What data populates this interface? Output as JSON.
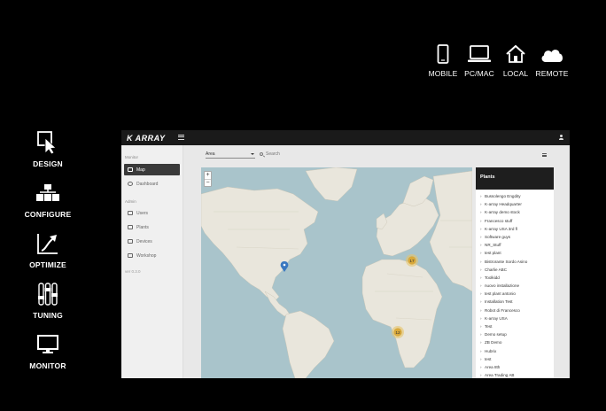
{
  "platforms": [
    {
      "icon": "mobile-icon",
      "label": "MOBILE"
    },
    {
      "icon": "laptop-icon",
      "label": "PC/MAC"
    },
    {
      "icon": "home-icon",
      "label": "LOCAL"
    },
    {
      "icon": "cloud-icon",
      "label": "REMOTE"
    }
  ],
  "features": [
    {
      "icon": "design-icon",
      "label": "DESIGN"
    },
    {
      "icon": "configure-icon",
      "label": "CONFIGURE"
    },
    {
      "icon": "optimize-icon",
      "label": "OPTIMIZE"
    },
    {
      "icon": "tuning-icon",
      "label": "TUNING"
    },
    {
      "icon": "monitor-icon",
      "label": "MONITOR"
    }
  ],
  "app": {
    "logo_text": "K ARRAY",
    "sidebar": {
      "section_monitor": "Monitor",
      "items_monitor": [
        {
          "label": "Map",
          "active": true
        },
        {
          "label": "Dashboard",
          "active": false
        }
      ],
      "section_admin": "Admin",
      "items_admin": [
        {
          "label": "Users"
        },
        {
          "label": "Plants"
        },
        {
          "label": "Devices"
        },
        {
          "label": "Workshop"
        }
      ],
      "version": "ver 0.3.0"
    },
    "toolbar": {
      "area_select": "Area",
      "search_placeholder": "Search"
    },
    "map": {
      "zoom_in": "+",
      "zoom_out": "−",
      "clusters": [
        {
          "count": "17",
          "color": "#d9a93a"
        },
        {
          "count": "12",
          "color": "#d9a93a"
        }
      ],
      "marker_color": "#3a78c0"
    },
    "plants_panel": {
      "title": "Plants",
      "items": [
        "Bussolengo Engdity",
        "K-array Headquarter",
        "K-array demo stock",
        "Francesco stuff",
        "K-array USA 3rd fl",
        "Software guys",
        "NR_Stuff",
        "test plant",
        "Bistrorante Sordo Asino",
        "Charlie ABC",
        "Toolkidd",
        "nuovo installazione",
        "test plant antonio",
        "Installation Test",
        "Robot di Francesco",
        "K-array USA",
        "Test",
        "Demo setup",
        "ZB Demo",
        "Hubrix",
        "test",
        "Area 8th",
        "Area Trading AB"
      ]
    }
  }
}
